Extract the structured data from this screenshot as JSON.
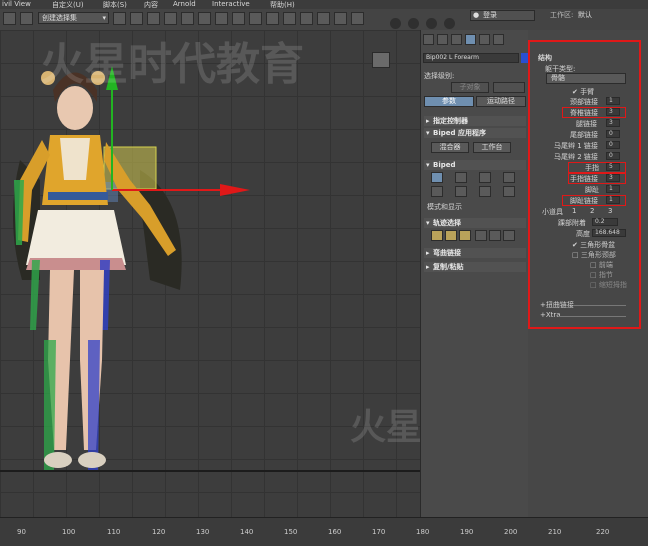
{
  "menubar": {
    "items": [
      "ivil View",
      "自定义(U)",
      "脚本(S)",
      "内容",
      "Arnold",
      "Interactive",
      "帮助(H)"
    ]
  },
  "toolbar": {
    "selection_set": "创建选择集",
    "login": "登录",
    "workspace_label": "工作区:",
    "workspace_value": "默认"
  },
  "panel": {
    "object_name": "Bip002 L Forearm",
    "selection_level_label": "选择级别:",
    "sub_object_button": "子对象",
    "params_tab": "参数",
    "motion_path_tab": "运动路径",
    "rollout_assign_controller": "指定控制器",
    "rollout_biped_app": "Biped 应用程序",
    "mixer_button": "混合器",
    "workbench_button": "工作台",
    "rollout_biped": "Biped",
    "mode_display": "模式和显示",
    "rollout_track_select": "轨迹选择",
    "rollout_bend_links": "弯曲链接",
    "rollout_copy_paste": "复制/粘贴"
  },
  "structure": {
    "title": "结构",
    "body_type_label": "躯干类型:",
    "body_type_value": "骨骼",
    "arms_label": "手臂",
    "fields": [
      {
        "label": "颈部链接",
        "value": "1"
      },
      {
        "label": "脊椎链接",
        "value": "3"
      },
      {
        "label": "腿链接",
        "value": "3"
      },
      {
        "label": "尾部链接",
        "value": "0"
      },
      {
        "label": "马尾辫 1 链接",
        "value": "0"
      },
      {
        "label": "马尾辫 2 链接",
        "value": "0"
      },
      {
        "label": "手指",
        "value": "5"
      },
      {
        "label": "手指链接",
        "value": "3"
      },
      {
        "label": "脚趾",
        "value": "1"
      },
      {
        "label": "脚趾链接",
        "value": "1"
      }
    ],
    "props_label": "小道具",
    "props_values": [
      "1",
      "2",
      "3"
    ],
    "ankle_label": "踝部附着",
    "ankle_value": "0.2",
    "height_label": "高度",
    "height_value": "168.648",
    "triangle_pelvis": "三角形骨盆",
    "triangle_neck": "三角形颈部",
    "forefoot": "前端",
    "finger": "指节",
    "short_thumb": "缩短拇指",
    "twist_links": "扭曲链接",
    "xtra": "Xtra"
  },
  "timeline": {
    "ticks": [
      "90",
      "100",
      "110",
      "120",
      "130",
      "140",
      "150",
      "160",
      "170",
      "180",
      "190",
      "200",
      "210",
      "220"
    ]
  },
  "watermark": {
    "text": "火星时代",
    "text2": "火星时代教育"
  },
  "colors": {
    "highlight": "#e01818",
    "active_tab": "#6f8fb0"
  }
}
